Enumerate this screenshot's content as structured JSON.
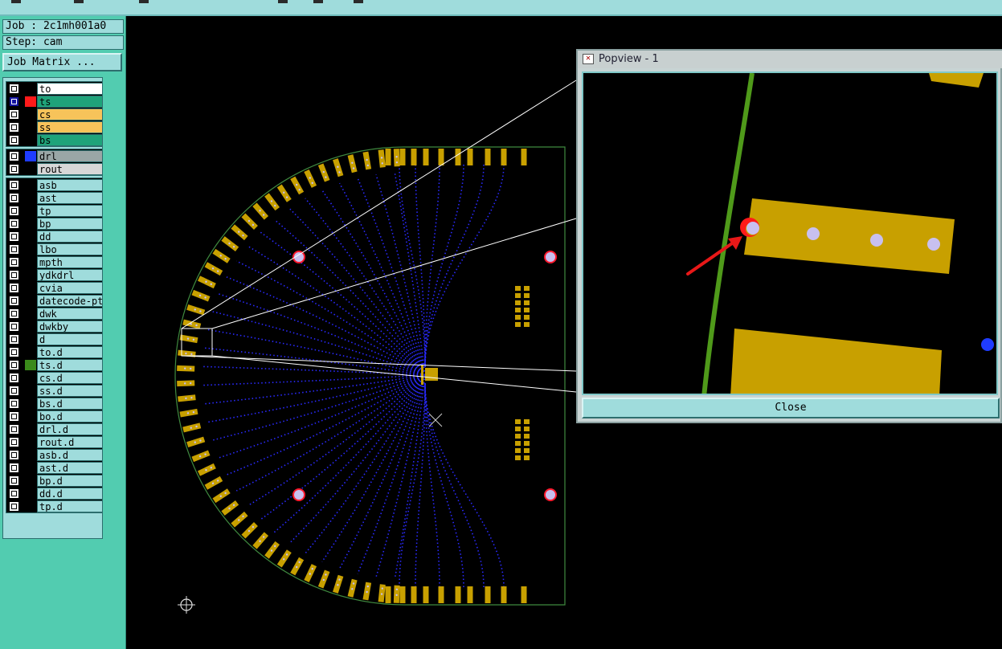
{
  "job_info": {
    "job": "Job : 2c1mh001a0",
    "step": "Step: cam",
    "job_matrix_button": "Job Matrix ..."
  },
  "colors": {
    "panel_bg": "#52ccb0",
    "field_bg": "#9fdcdc",
    "pad_copper": "#c8a000",
    "trace_blue": "#2a2aff",
    "outline_green": "#3f8a3f",
    "via_lavender": "#c8c0f0",
    "drill_red": "#ff1a2e",
    "arrow_red": "#e81818"
  },
  "layer_groups": [
    {
      "layers": [
        {
          "name": "to",
          "color": "#ffffff",
          "swatch": "",
          "active": false
        },
        {
          "name": "ts",
          "color": "#1fa37a",
          "swatch": "#ff1a1a",
          "active": true
        },
        {
          "name": "cs",
          "color": "#f7c35a",
          "swatch": "",
          "active": false
        },
        {
          "name": "ss",
          "color": "#f7c35a",
          "swatch": "",
          "active": false
        },
        {
          "name": "bs",
          "color": "#1fa37a",
          "swatch": "",
          "active": false
        }
      ]
    },
    {
      "layers": [
        {
          "name": "drl",
          "color": "#9aa6a6",
          "swatch": "#1f3cff",
          "active": false
        },
        {
          "name": "rout",
          "color": "#d7d7d7",
          "swatch": "",
          "active": false
        }
      ]
    },
    {
      "layers": [
        {
          "name": "asb",
          "color": "#9fdcdc",
          "swatch": "",
          "active": false
        },
        {
          "name": "ast",
          "color": "#9fdcdc",
          "swatch": "",
          "active": false
        },
        {
          "name": "tp",
          "color": "#9fdcdc",
          "swatch": "",
          "active": false
        },
        {
          "name": "bp",
          "color": "#9fdcdc",
          "swatch": "",
          "active": false
        },
        {
          "name": "dd",
          "color": "#9fdcdc",
          "swatch": "",
          "active": false
        },
        {
          "name": "lbo",
          "color": "#9fdcdc",
          "swatch": "",
          "active": false
        },
        {
          "name": "mpth",
          "color": "#9fdcdc",
          "swatch": "",
          "active": false
        },
        {
          "name": "ydkdrl",
          "color": "#9fdcdc",
          "swatch": "",
          "active": false
        },
        {
          "name": "cvia",
          "color": "#9fdcdc",
          "swatch": "",
          "active": false
        },
        {
          "name": "datecode-pt",
          "color": "#9fdcdc",
          "swatch": "",
          "active": false
        },
        {
          "name": "dwk",
          "color": "#9fdcdc",
          "swatch": "",
          "active": false
        },
        {
          "name": "dwkby",
          "color": "#9fdcdc",
          "swatch": "",
          "active": false
        },
        {
          "name": "d",
          "color": "#9fdcdc",
          "swatch": "",
          "active": false
        },
        {
          "name": "to.d",
          "color": "#9fdcdc",
          "swatch": "",
          "active": false
        },
        {
          "name": "ts.d",
          "color": "#9fdcdc",
          "swatch": "#3a8a1a",
          "active": false
        },
        {
          "name": "cs.d",
          "color": "#9fdcdc",
          "swatch": "",
          "active": false
        },
        {
          "name": "ss.d",
          "color": "#9fdcdc",
          "swatch": "",
          "active": false
        },
        {
          "name": "bs.d",
          "color": "#9fdcdc",
          "swatch": "",
          "active": false
        },
        {
          "name": "bo.d",
          "color": "#9fdcdc",
          "swatch": "",
          "active": false
        },
        {
          "name": "drl.d",
          "color": "#9fdcdc",
          "swatch": "",
          "active": false
        },
        {
          "name": "rout.d",
          "color": "#9fdcdc",
          "swatch": "",
          "active": false
        },
        {
          "name": "asb.d",
          "color": "#9fdcdc",
          "swatch": "",
          "active": false
        },
        {
          "name": "ast.d",
          "color": "#9fdcdc",
          "swatch": "",
          "active": false
        },
        {
          "name": "bp.d",
          "color": "#9fdcdc",
          "swatch": "",
          "active": false
        },
        {
          "name": "dd.d",
          "color": "#9fdcdc",
          "swatch": "",
          "active": false
        },
        {
          "name": "tp.d",
          "color": "#9fdcdc",
          "swatch": "",
          "active": false
        }
      ]
    }
  ],
  "popview": {
    "title": "Popview - 1",
    "close_label": "Close"
  },
  "icons": [
    "app-icon",
    "origin-crosshair-icon",
    "center-x-marker-icon",
    "red-arrow-annotation"
  ]
}
